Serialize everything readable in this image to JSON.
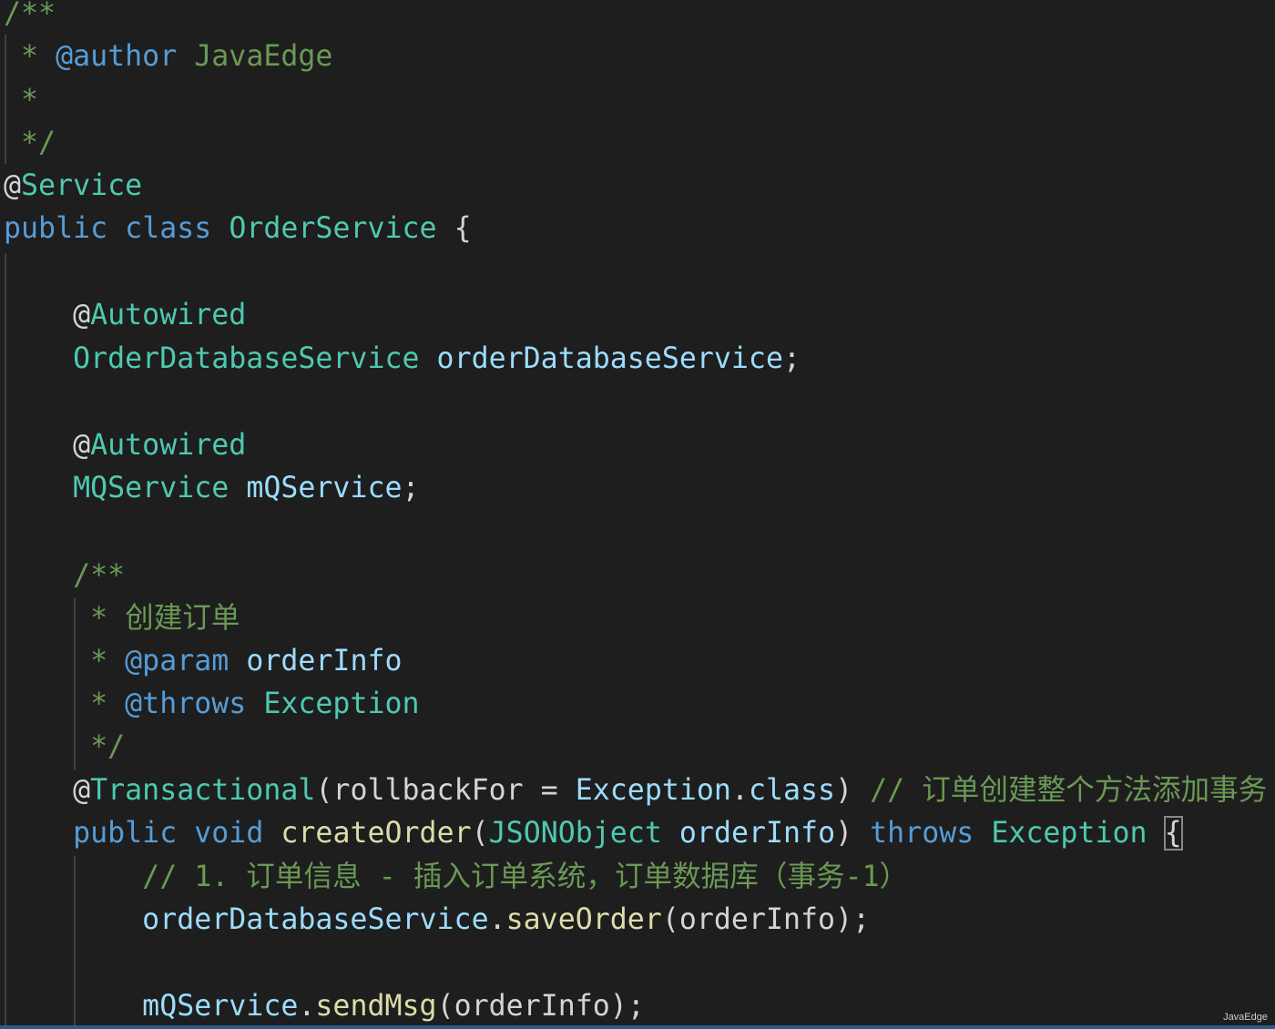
{
  "theme": {
    "background": "#1e1e1e",
    "comment": "#6a9955",
    "keyword": "#569cd6",
    "type": "#4ec9b0",
    "variable": "#9cdcfe",
    "function": "#dcdcaa",
    "plain": "#d4d4d4"
  },
  "code": {
    "lines": [
      {
        "tokens": [
          {
            "t": "/**",
            "k": "comment"
          }
        ]
      },
      {
        "tokens": [
          {
            "t": " * ",
            "k": "comment"
          },
          {
            "t": "@author",
            "k": "keyword"
          },
          {
            "t": " JavaEdge",
            "k": "comment"
          }
        ]
      },
      {
        "tokens": [
          {
            "t": " *",
            "k": "comment"
          }
        ]
      },
      {
        "tokens": [
          {
            "t": " */",
            "k": "comment"
          }
        ]
      },
      {
        "tokens": [
          {
            "t": "@",
            "k": "plain"
          },
          {
            "t": "Service",
            "k": "type"
          }
        ]
      },
      {
        "tokens": [
          {
            "t": "public",
            "k": "keyword"
          },
          {
            "t": " ",
            "k": "plain"
          },
          {
            "t": "class",
            "k": "keyword"
          },
          {
            "t": " ",
            "k": "plain"
          },
          {
            "t": "OrderService",
            "k": "type"
          },
          {
            "t": " {",
            "k": "plain"
          }
        ]
      },
      {
        "tokens": []
      },
      {
        "tokens": [
          {
            "t": "    @",
            "k": "plain"
          },
          {
            "t": "Autowired",
            "k": "type"
          }
        ]
      },
      {
        "tokens": [
          {
            "t": "    ",
            "k": "plain"
          },
          {
            "t": "OrderDatabaseService",
            "k": "type"
          },
          {
            "t": " ",
            "k": "plain"
          },
          {
            "t": "orderDatabaseService",
            "k": "variable"
          },
          {
            "t": ";",
            "k": "plain"
          }
        ]
      },
      {
        "tokens": []
      },
      {
        "tokens": [
          {
            "t": "    @",
            "k": "plain"
          },
          {
            "t": "Autowired",
            "k": "type"
          }
        ]
      },
      {
        "tokens": [
          {
            "t": "    ",
            "k": "plain"
          },
          {
            "t": "MQService",
            "k": "type"
          },
          {
            "t": " ",
            "k": "plain"
          },
          {
            "t": "mQService",
            "k": "variable"
          },
          {
            "t": ";",
            "k": "plain"
          }
        ]
      },
      {
        "tokens": []
      },
      {
        "tokens": [
          {
            "t": "    /**",
            "k": "comment"
          }
        ]
      },
      {
        "tokens": [
          {
            "t": "     * 创建订单",
            "k": "comment"
          }
        ]
      },
      {
        "tokens": [
          {
            "t": "     * ",
            "k": "comment"
          },
          {
            "t": "@param",
            "k": "keyword"
          },
          {
            "t": " ",
            "k": "comment"
          },
          {
            "t": "orderInfo",
            "k": "variable"
          }
        ]
      },
      {
        "tokens": [
          {
            "t": "     * ",
            "k": "comment"
          },
          {
            "t": "@throws",
            "k": "keyword"
          },
          {
            "t": " ",
            "k": "comment"
          },
          {
            "t": "Exception",
            "k": "type"
          }
        ]
      },
      {
        "tokens": [
          {
            "t": "     */",
            "k": "comment"
          }
        ]
      },
      {
        "tokens": [
          {
            "t": "    @",
            "k": "plain"
          },
          {
            "t": "Transactional",
            "k": "type"
          },
          {
            "t": "(",
            "k": "plain"
          },
          {
            "t": "rollbackFor",
            "k": "plain"
          },
          {
            "t": " = ",
            "k": "plain"
          },
          {
            "t": "Exception",
            "k": "var"
          },
          {
            "t": ".",
            "k": "plain"
          },
          {
            "t": "class",
            "k": "var"
          },
          {
            "t": ") ",
            "k": "plain"
          },
          {
            "t": "// 订单创建整个方法添加事务",
            "k": "comment"
          }
        ]
      },
      {
        "tokens": [
          {
            "t": "    ",
            "k": "plain"
          },
          {
            "t": "public",
            "k": "keyword"
          },
          {
            "t": " ",
            "k": "plain"
          },
          {
            "t": "void",
            "k": "keyword"
          },
          {
            "t": " ",
            "k": "plain"
          },
          {
            "t": "createOrder",
            "k": "function"
          },
          {
            "t": "(",
            "k": "plain"
          },
          {
            "t": "JSONObject",
            "k": "type"
          },
          {
            "t": " ",
            "k": "plain"
          },
          {
            "t": "orderInfo",
            "k": "variable"
          },
          {
            "t": ") ",
            "k": "plain"
          },
          {
            "t": "throws",
            "k": "keyword"
          },
          {
            "t": " ",
            "k": "plain"
          },
          {
            "t": "Exception",
            "k": "type"
          },
          {
            "t": " ",
            "k": "plain"
          },
          {
            "t": "{",
            "k": "brace-match"
          }
        ]
      },
      {
        "tokens": [
          {
            "t": "        // 1. 订单信息 - 插入订单系统，订单数据库（事务-1）",
            "k": "comment"
          }
        ]
      },
      {
        "tokens": [
          {
            "t": "        ",
            "k": "plain"
          },
          {
            "t": "orderDatabaseService",
            "k": "variable"
          },
          {
            "t": ".",
            "k": "plain"
          },
          {
            "t": "saveOrder",
            "k": "function"
          },
          {
            "t": "(",
            "k": "plain"
          },
          {
            "t": "orderInfo",
            "k": "plain"
          },
          {
            "t": ");",
            "k": "plain"
          }
        ]
      },
      {
        "tokens": []
      },
      {
        "tokens": [
          {
            "t": "        ",
            "k": "plain"
          },
          {
            "t": "mQService",
            "k": "variable"
          },
          {
            "t": ".",
            "k": "plain"
          },
          {
            "t": "sendMsg",
            "k": "function"
          },
          {
            "t": "(",
            "k": "plain"
          },
          {
            "t": "orderInfo",
            "k": "plain"
          },
          {
            "t": ");",
            "k": "plain"
          }
        ]
      }
    ]
  },
  "watermark": "JavaEdge"
}
